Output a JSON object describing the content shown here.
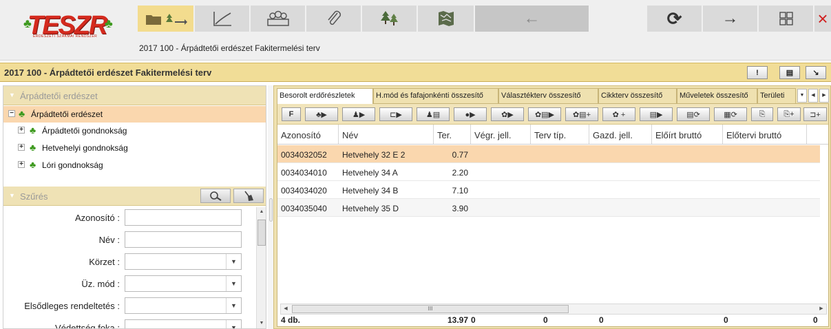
{
  "app": {
    "logo_text": "TESZR",
    "logo_subtext": "ERDÉSZETI SZAKMAI RENDSZER",
    "header_title": "2017 100 - Árpádtetői erdészet Fakitermelési terv"
  },
  "toolbar": {
    "buttons": [
      {
        "name": "folder-trees-button",
        "icon": "folder-with-trees"
      },
      {
        "name": "chart-button",
        "icon": "line-chart"
      },
      {
        "name": "people-button",
        "icon": "people"
      },
      {
        "name": "attachment-button",
        "icon": "paperclip"
      },
      {
        "name": "trees-button",
        "icon": "trees"
      },
      {
        "name": "map-button",
        "icon": "map"
      },
      {
        "name": "back-button",
        "icon": "arrow-left",
        "glyph": "←"
      },
      {
        "name": "refresh-button",
        "icon": "refresh",
        "glyph": "⟳"
      },
      {
        "name": "forward-button",
        "icon": "arrow-right",
        "glyph": "→"
      },
      {
        "name": "windows-button",
        "icon": "grid"
      },
      {
        "name": "close-button",
        "icon": "close",
        "glyph": "×"
      }
    ]
  },
  "page_bar": {
    "title": "2017 100 - Árpádtetői erdészet Fakitermelési terv",
    "buttons": [
      {
        "icon": "exclamation",
        "glyph": "!"
      },
      {
        "icon": "list",
        "glyph": "▤"
      },
      {
        "icon": "collapse",
        "glyph": "↘"
      }
    ]
  },
  "tree_panel": {
    "header": "Árpádtetői erdészet",
    "root": {
      "label": "Árpádtetői erdészet",
      "expander": "⊟"
    },
    "children": [
      {
        "label": "Árpádtetői gondnokság",
        "expander": "+"
      },
      {
        "label": "Hetvehelyi gondnokság",
        "expander": "+"
      },
      {
        "label": "Lóri gondnokság",
        "expander": "+"
      }
    ]
  },
  "filter_panel": {
    "header": "Szűrés",
    "fields": [
      {
        "label": "Azonosító :",
        "type": "text",
        "value": ""
      },
      {
        "label": "Név :",
        "type": "text",
        "value": ""
      },
      {
        "label": "Körzet :",
        "type": "select",
        "value": ""
      },
      {
        "label": "Üz. mód :",
        "type": "select",
        "value": ""
      },
      {
        "label": "Elsődleges rendeltetés :",
        "type": "select",
        "value": ""
      },
      {
        "label": "Védettség foka :",
        "type": "select",
        "value": ""
      }
    ]
  },
  "tabs": [
    {
      "label": "Besorolt erdőrészletek",
      "active": true
    },
    {
      "label": "H.mód és fafajonkénti összesítő",
      "active": false
    },
    {
      "label": "Választékterv összesítő",
      "active": false
    },
    {
      "label": "Cikkterv összesítő",
      "active": false
    },
    {
      "label": "Műveletek összesítő",
      "active": false
    },
    {
      "label": "Területi",
      "active": false
    }
  ],
  "grid_toolbar": {
    "buttons": [
      {
        "icon": "filter",
        "label": "F"
      },
      {
        "icon": "tree-go",
        "label": "♣▶"
      },
      {
        "icon": "people-go",
        "label": "♟▶"
      },
      {
        "icon": "truck-go",
        "label": "⊏▶"
      },
      {
        "icon": "people-list",
        "label": "♟▤"
      },
      {
        "icon": "circle-go",
        "label": "●▶"
      },
      {
        "icon": "gear-go",
        "label": "✿▶"
      },
      {
        "icon": "gear-doc-go",
        "label": "✿▤▶"
      },
      {
        "icon": "gear-doc-add",
        "label": "✿▤+"
      },
      {
        "icon": "gear-add",
        "label": "✿ +"
      },
      {
        "icon": "doc-go",
        "label": "▤▶"
      },
      {
        "icon": "doc-refresh",
        "label": "▤⟳"
      },
      {
        "icon": "grid-refresh",
        "label": "▦⟳"
      },
      {
        "icon": "doc-export",
        "label": "⎘"
      },
      {
        "icon": "doc-add",
        "label": "⎘+"
      },
      {
        "icon": "comment-add",
        "label": "⊐+"
      }
    ]
  },
  "grid": {
    "columns": [
      "Azonosító",
      "Név",
      "Ter.",
      "Végr. jell.",
      "Terv típ.",
      "Gazd. jell.",
      "Előírt bruttó",
      "Előtervi bruttó"
    ],
    "rows": [
      {
        "id": "0034032052",
        "name": "Hetvehely 32 E 2",
        "area": "0.77",
        "selected": true
      },
      {
        "id": "0034034010",
        "name": "Hetvehely 34 A",
        "area": "2.20",
        "selected": false
      },
      {
        "id": "0034034020",
        "name": "Hetvehely 34 B",
        "area": "7.10",
        "selected": false
      },
      {
        "id": "0034035040",
        "name": "Hetvehely 35 D",
        "area": "3.90",
        "selected": false
      }
    ],
    "scroll_thumb_text": "III",
    "footer": {
      "count": "4 db.",
      "area_total": "13.97",
      "col4": "0",
      "col5": "0",
      "col6": "0",
      "col7": "0",
      "col8": "0"
    }
  },
  "colors": {
    "accent": "#f1dd97",
    "selection": "#fad7ae",
    "close": "#d02020",
    "logo": "#d42a1e"
  }
}
